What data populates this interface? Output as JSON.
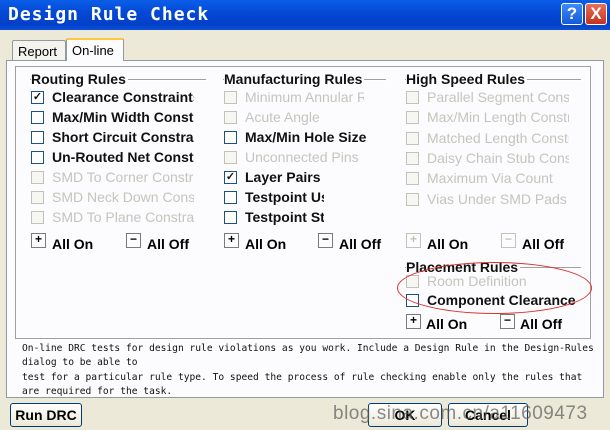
{
  "window": {
    "title": "Design Rule Check",
    "help_icon": "?",
    "close_icon": "X"
  },
  "tabs": [
    {
      "label": "Report",
      "active": false
    },
    {
      "label": "On-line",
      "active": true
    }
  ],
  "routing": {
    "title": "Routing Rules",
    "items": [
      {
        "label": "Clearance Constraints",
        "checked": true,
        "enabled": true
      },
      {
        "label": "Max/Min Width Constraint",
        "checked": false,
        "enabled": true
      },
      {
        "label": "Short Circuit Constraint",
        "checked": false,
        "enabled": true
      },
      {
        "label": "Un-Routed Net Constraint",
        "checked": false,
        "enabled": true
      },
      {
        "label": "SMD To Corner Constraint",
        "checked": false,
        "enabled": false
      },
      {
        "label": "SMD Neck Down Constraint",
        "checked": false,
        "enabled": false
      },
      {
        "label": "SMD To Plane Constraint",
        "checked": false,
        "enabled": false
      }
    ],
    "all_on": "All On",
    "all_off": "All Off"
  },
  "manufacturing": {
    "title": "Manufacturing Rules",
    "items": [
      {
        "label": "Minimum Annular Ring",
        "checked": false,
        "enabled": false
      },
      {
        "label": "Acute Angle",
        "checked": false,
        "enabled": false
      },
      {
        "label": "Max/Min Hole Size",
        "checked": false,
        "enabled": true
      },
      {
        "label": "Unconnected Pins",
        "checked": false,
        "enabled": false
      },
      {
        "label": "Layer Pairs",
        "checked": true,
        "enabled": true
      },
      {
        "label": "Testpoint Usage",
        "checked": false,
        "enabled": true
      },
      {
        "label": "Testpoint Style",
        "checked": false,
        "enabled": true
      }
    ],
    "all_on": "All On",
    "all_off": "All Off"
  },
  "highspeed": {
    "title": "High Speed Rules",
    "items": [
      {
        "label": "Parallel Segment Constraint",
        "checked": false,
        "enabled": false
      },
      {
        "label": "Max/Min Length Constraint",
        "checked": false,
        "enabled": false
      },
      {
        "label": "Matched Length Constraint",
        "checked": false,
        "enabled": false
      },
      {
        "label": "Daisy Chain Stub Constraint",
        "checked": false,
        "enabled": false
      },
      {
        "label": "Maximum Via Count",
        "checked": false,
        "enabled": false
      },
      {
        "label": "Vias Under SMD Pads",
        "checked": false,
        "enabled": false
      }
    ],
    "all_on": "All On",
    "all_off": "All Off"
  },
  "placement": {
    "title": "Placement Rules",
    "items": [
      {
        "label": "Room Definition",
        "checked": false,
        "enabled": false
      },
      {
        "label": "Component Clearance",
        "checked": false,
        "enabled": true
      }
    ],
    "all_on": "All On",
    "all_off": "All Off"
  },
  "description": "On-line DRC tests for design rule violations as you work. Include a Design Rule in the Design-Rules dialog to be able to\ntest for a particular rule type. To speed the process of rule checking enable only the rules that are required for the task.",
  "buttons": {
    "run": "Run DRC",
    "ok": "OK",
    "cancel": "Cancel"
  },
  "watermark": "blog.sina.com.cn/a11609473",
  "colors": {
    "titlebar": "#0449d6",
    "annotation": "#d8342c",
    "check": "#21a121"
  }
}
